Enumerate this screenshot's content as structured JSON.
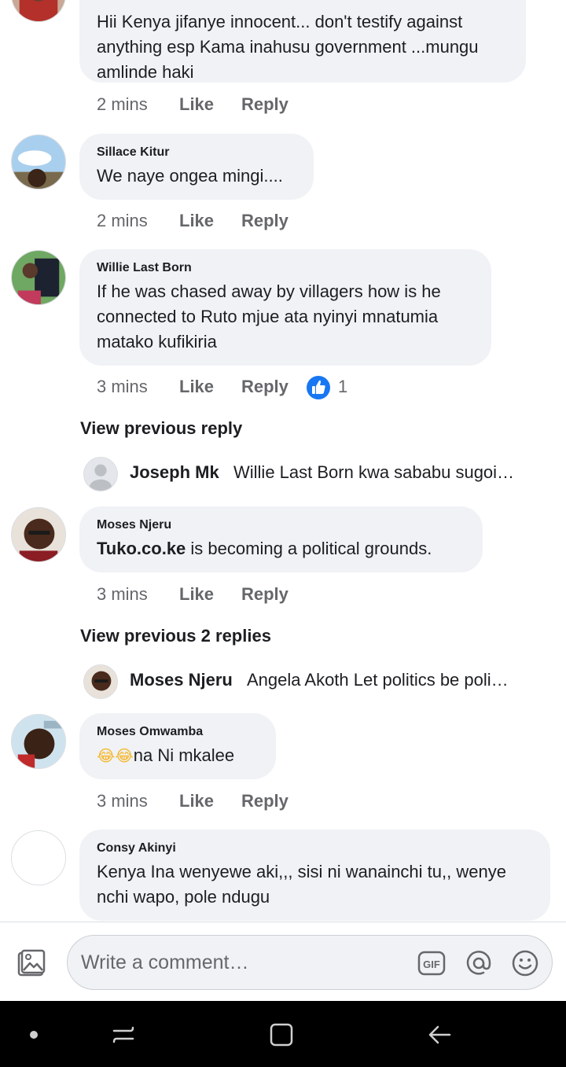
{
  "comments": [
    {
      "author": "",
      "text": "Hii Kenya jifanye innocent... don't testify against anything esp Kama inahusu government ...mungu amlinde haki",
      "time": "2 mins",
      "like": "Like",
      "reply": "Reply"
    },
    {
      "author": "Sillace Kitur",
      "text": "We naye ongea mingi....",
      "time": "2 mins",
      "like": "Like",
      "reply": "Reply"
    },
    {
      "author": "Willie Last Born",
      "text": "If he was chased away by villagers how is he connected to Ruto mjue ata nyinyi mnatumia matako kufikiria",
      "time": "3 mins",
      "like": "Like",
      "reply": "Reply",
      "reaction": {
        "icon": "like-reaction-icon",
        "count": "1"
      },
      "view_previous": "View previous reply",
      "reply_preview": {
        "name": "Joseph Mk",
        "text": "Willie Last Born kwa sababu sugoi…"
      }
    },
    {
      "author": "Moses Njeru",
      "link": "Tuko.co.ke",
      "text": " is becoming a political grounds.",
      "time": "3 mins",
      "like": "Like",
      "reply": "Reply",
      "view_previous": "View previous 2 replies",
      "reply_preview": {
        "name": "Moses Njeru",
        "text": "Angela Akoth Let politics be poli…"
      }
    },
    {
      "author": "Moses Omwamba",
      "text": "na Ni mkalee",
      "emoji": "😂😂",
      "time": "3 mins",
      "like": "Like",
      "reply": "Reply"
    },
    {
      "author": "Consy Akinyi",
      "text": "Kenya Ina wenyewe aki,,, sisi ni wanainchi tu,, wenye nchi wapo, pole ndugu"
    }
  ],
  "composer": {
    "placeholder": "Write a comment…",
    "icons": [
      "photo-icon",
      "gif-icon",
      "mention-icon",
      "emoji-icon"
    ],
    "gif_label": "GIF"
  },
  "nav": {
    "icons": [
      "dot-icon",
      "recents-icon",
      "home-icon",
      "back-icon"
    ]
  },
  "colors": {
    "bubble": "#f0f2f5",
    "muted": "#65676b",
    "like_blue": "#1877f2",
    "nav_bg": "#000000"
  }
}
